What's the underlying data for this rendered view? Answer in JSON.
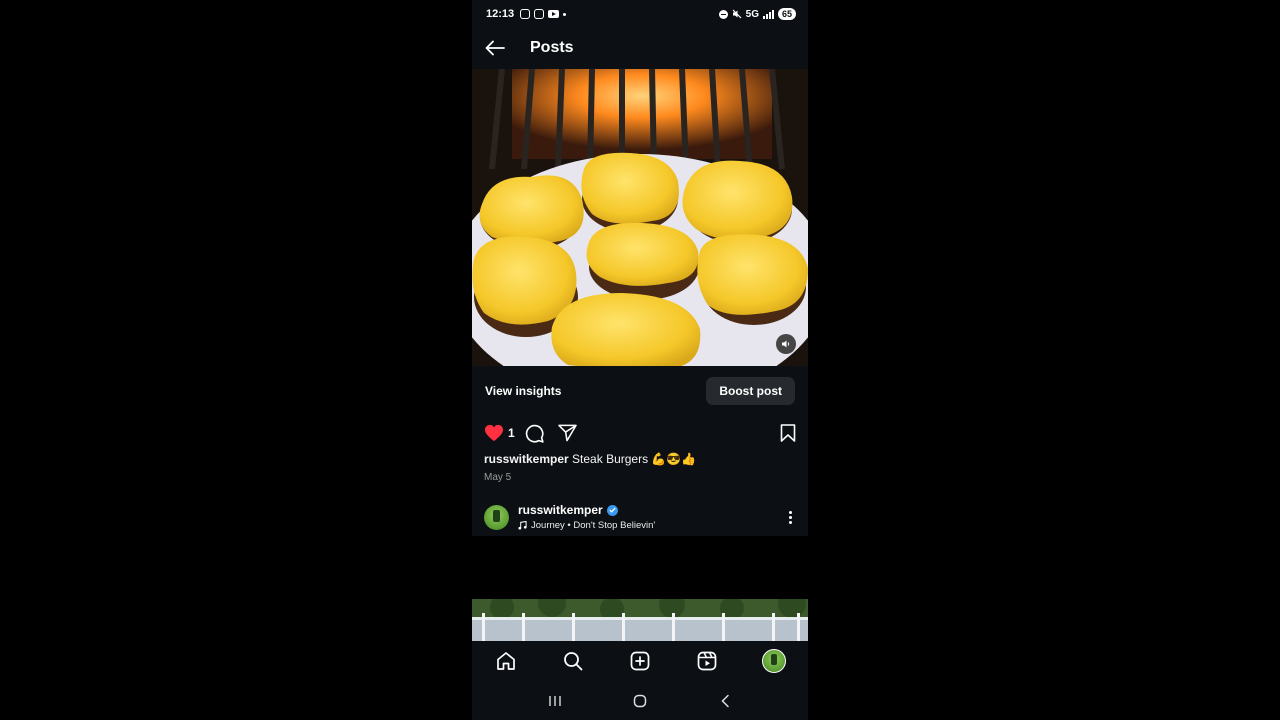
{
  "status_bar": {
    "time": "12:13",
    "network": "5G",
    "battery": "65"
  },
  "header": {
    "title": "Posts"
  },
  "post": {
    "view_insights_label": "View insights",
    "boost_label": "Boost post",
    "like_count": "1",
    "caption_user": "russwitkemper",
    "caption_text": "Steak Burgers 💪😎👍",
    "date": "May 5"
  },
  "next_post": {
    "username": "russwitkemper",
    "music": "Journey • Don't Stop Believin'"
  },
  "colors": {
    "background": "#0c1014",
    "like": "#ff3040",
    "verified": "#3897f0",
    "boost_button": "#262a2f"
  },
  "icons": {
    "back": "back-arrow-icon",
    "like": "heart-icon",
    "comment": "comment-icon",
    "share": "share-icon",
    "save": "bookmark-icon",
    "mute": "speaker-icon",
    "music": "music-note-icon",
    "more": "more-vertical-icon",
    "home": "home-icon",
    "search": "search-icon",
    "create": "plus-square-icon",
    "reels": "reels-icon"
  }
}
